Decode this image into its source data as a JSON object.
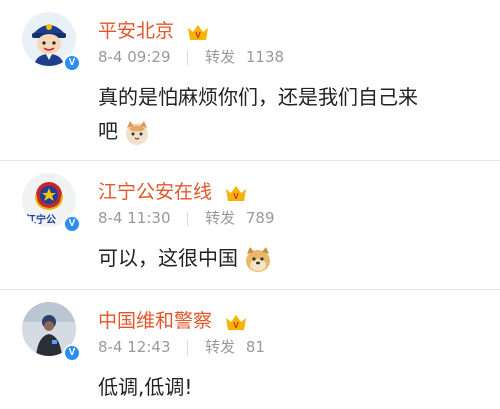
{
  "comments": [
    {
      "name": "平安北京",
      "date": "8-4 09:29",
      "repost_label": "转发",
      "repost_count": "1138",
      "text_line1": "真的是怕麻烦你们，还是我们自己来",
      "text_line2": "吧",
      "emoji": "cat-emoji",
      "avatar": "police-cartoon-avatar"
    },
    {
      "name": "江宁公安在线",
      "date": "8-4 11:30",
      "repost_label": "转发",
      "repost_count": "789",
      "text_line1": "可以，这很中国",
      "emoji": "doge-emoji",
      "avatar": "police-emblem-avatar",
      "avatar_text": "江宁公"
    },
    {
      "name": "中国维和警察",
      "date": "8-4 12:43",
      "repost_label": "转发",
      "repost_count": "81",
      "text_line1": "低调,低调!",
      "avatar": "peacekeeper-photo-avatar"
    }
  ],
  "colors": {
    "name": "#e4562b",
    "verified_badge": "#2b8ef0",
    "meta": "#9a9a9a"
  }
}
